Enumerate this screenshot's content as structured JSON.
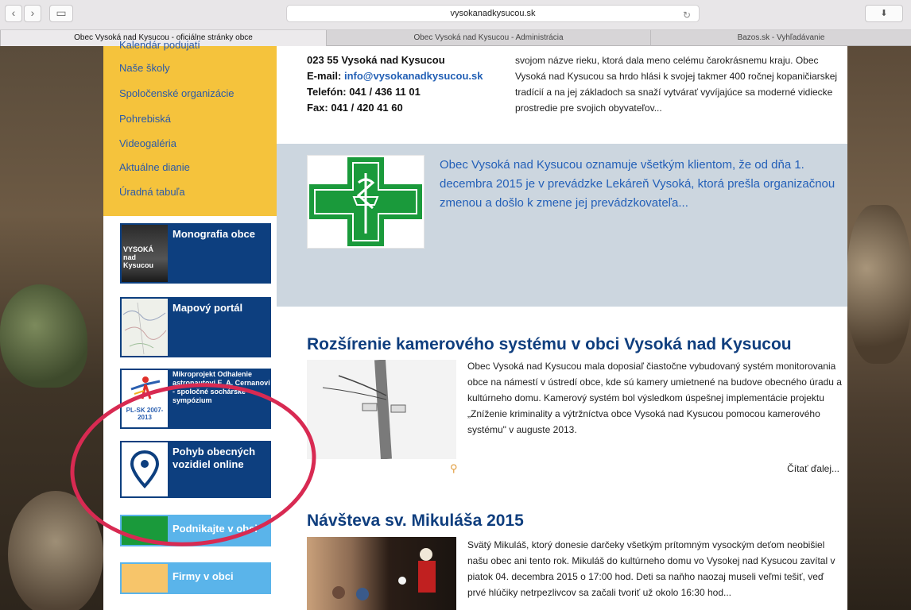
{
  "browser": {
    "url": "vysokanadkysucou.sk",
    "tabs": [
      {
        "label": "Obec Vysoká nad Kysucou - oficiálne stránky obce",
        "active": true
      },
      {
        "label": "Obec Vysoká nad Kysucou - Administrácia",
        "active": false
      },
      {
        "label": "Bazos.sk - Vyhľadávanie",
        "active": false
      }
    ]
  },
  "sidebar": {
    "menu": [
      "Kalendár podujatí",
      "Naše školy",
      "Spoločenské organizácie",
      "Pohrebiská",
      "Videogaléria",
      "Aktuálne dianie",
      "Úradná tabuľa"
    ],
    "banners": [
      {
        "label": "Monografia obce",
        "thumb_text": "VYSOKÁ nad Kysucou"
      },
      {
        "label": "Mapový portál"
      },
      {
        "label": "Mikroprojekt Odhalenie astronautovi E. A. Cernanovi - spoločné sochárske sympózium",
        "thumb_text": "PL-SK 2007-2013"
      },
      {
        "label": "Pohyb obecných vozidiel online"
      },
      {
        "label": "Podnikajte v obci"
      },
      {
        "label": "Firmy v obci"
      }
    ]
  },
  "main": {
    "contact": {
      "address": "023 55 Vysoká nad Kysucou",
      "email_label": "E-mail:",
      "email": "info@vysokanadkysucou.sk",
      "phone": "Telefón: 041 / 436 11 01",
      "fax": "Fax: 041 / 420 41 60"
    },
    "intro": "svojom názve rieku, ktorá dala meno celému čarokrásnemu kraju. Obec Vysoká nad Kysucou sa hrdo hlási k svojej takmer 400 ročnej kopaničiarskej tradícií a na jej základoch sa snaží vytvárať vyvíjajúce sa moderné vidiecke prostredie pre svojich obyvateľov...",
    "notice": "Obec Vysoká nad Kysucou oznamuje všetkým klientom, že od dňa 1. decembra 2015 je v prevádzke Lekáreň Vysoká, ktorá prešla organizačnou zmenou a došlo k zmene jej prevádzkovateľa...",
    "articles": [
      {
        "title": "Rozšírenie kamerového systému v obci Vysoká nad Kysucou",
        "text": "Obec Vysoká nad Kysucou mala doposiaľ čiastočne vybudovaný systém monitorovania obce na námestí v ústredí obce, kde sú kamery umietnené na budove obecného úradu a kultúrneho domu. Kamerový systém bol výsledkom úspešnej implementácie projektu „Zníženie kriminality a výtržníctva obce Vysoká nad Kysucou pomocou kamerového systému\" v auguste 2013.",
        "read_more": "Čítať ďalej..."
      },
      {
        "title": "Návšteva sv. Mikuláša 2015",
        "text": "Svätý Mikuláš, ktorý donesie darčeky všetkým prítomným vysockým deťom neobišiel našu obec ani tento rok. Mikuláš do kultúrneho domu vo Vysokej nad Kysucou zavítal v piatok 04. decembra 2015 o 17:00 hod. Deti sa naňho naozaj museli veľmi tešiť, veď prvé hlúčiky netrpezlivcov sa začali tvoriť už okolo 16:30 hod..."
      }
    ]
  },
  "colors": {
    "menu_bg": "#f5c33c",
    "link": "#2b5aa8",
    "banner": "#0d3f7f",
    "pharmacy_green": "#1a9a3b",
    "annotation": "#d82a52",
    "light_blue": "#5ab4ea",
    "orange": "#f7c56a"
  }
}
